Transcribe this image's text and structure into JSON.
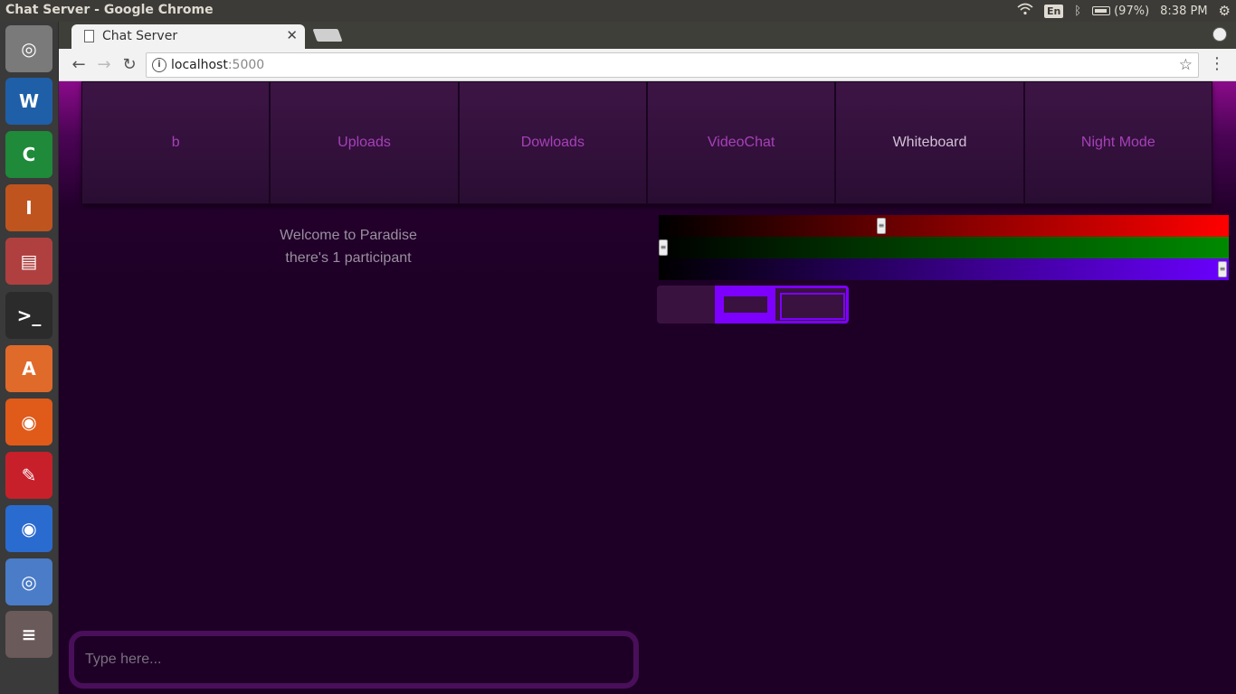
{
  "os": {
    "window_title": "Chat Server - Google Chrome",
    "keyboard_layout": "En",
    "battery": "(97%)",
    "clock": "8:38 PM"
  },
  "launcher": {
    "items": [
      {
        "name": "ubuntu-dash",
        "color": "#7a7a7a",
        "glyph": "◎"
      },
      {
        "name": "libreoffice-writer",
        "color": "#1f5fa8",
        "glyph": "W"
      },
      {
        "name": "libreoffice-calc",
        "color": "#1e8a3a",
        "glyph": "C"
      },
      {
        "name": "libreoffice-impress",
        "color": "#c0541e",
        "glyph": "I"
      },
      {
        "name": "files",
        "color": "#b04040",
        "glyph": "▤"
      },
      {
        "name": "terminal",
        "color": "#2b2b2b",
        "glyph": ">_"
      },
      {
        "name": "software-center",
        "color": "#e06a2a",
        "glyph": "A"
      },
      {
        "name": "firefox",
        "color": "#e05a1a",
        "glyph": "◉"
      },
      {
        "name": "document-viewer",
        "color": "#c8202a",
        "glyph": "✎"
      },
      {
        "name": "google-chrome",
        "color": "#2a6bd0",
        "glyph": "◉"
      },
      {
        "name": "chromium",
        "color": "#4a7cc8",
        "glyph": "◎"
      },
      {
        "name": "stacked-apps",
        "color": "#6a5a5a",
        "glyph": "≡"
      }
    ]
  },
  "browser": {
    "tab_title": "Chat Server",
    "url_host": "localhost",
    "url_port": ":5000"
  },
  "nav": {
    "items": [
      "b",
      "Uploads",
      "Dowloads",
      "VideoChat",
      "Whiteboard",
      "Night Mode"
    ],
    "active_index": 4
  },
  "welcome": {
    "line1": "Welcome to Paradise",
    "line2": "there's 1 participant"
  },
  "whiteboard": {
    "color_sliders": [
      {
        "channel": "red",
        "value": 0.39,
        "max_color": "#ff0000"
      },
      {
        "channel": "green",
        "value": 0.0,
        "max_color": "#008a00"
      },
      {
        "channel": "blue",
        "value": 1.0,
        "max_color": "#6a00ff"
      }
    ],
    "accent_color": "#7d00ff"
  },
  "chat": {
    "placeholder": "Type here..."
  }
}
